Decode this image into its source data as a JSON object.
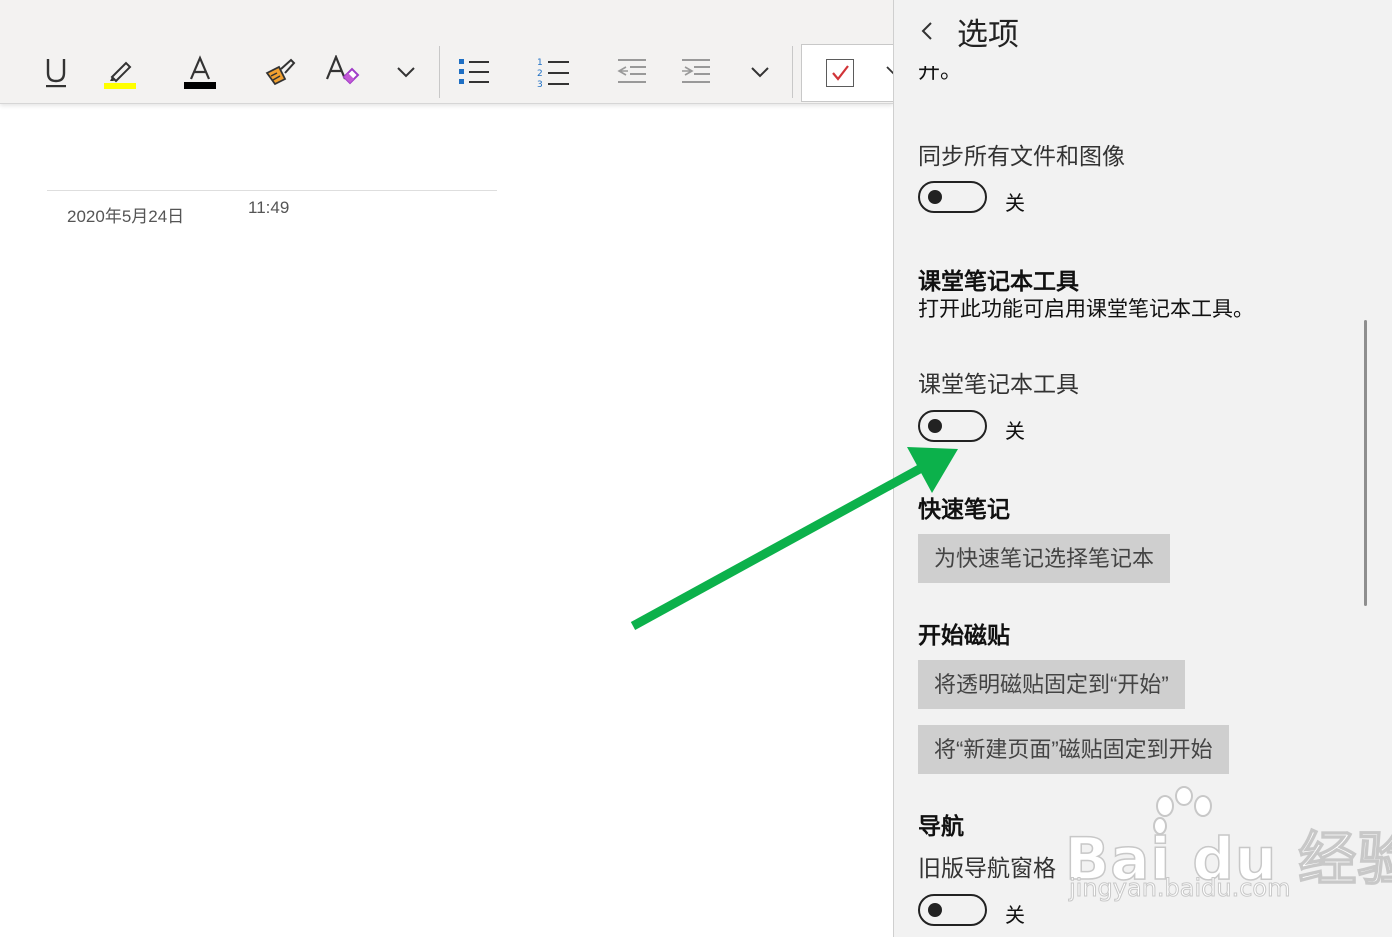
{
  "toolbar": {
    "buttons": [
      {
        "name": "underline-button",
        "icon": "underline-icon"
      },
      {
        "name": "highlight-button",
        "icon": "highlighter-icon",
        "color": "#ffff00"
      },
      {
        "name": "font-color-button",
        "icon": "font-color-icon",
        "color": "#000000"
      },
      {
        "name": "format-painter-button",
        "icon": "format-painter-icon"
      },
      {
        "name": "clear-formatting-button",
        "icon": "clear-formatting-icon"
      },
      {
        "name": "more-formatting-button",
        "icon": "chevron-down-icon"
      },
      {
        "name": "bulleted-list-button",
        "icon": "bullet-list-icon"
      },
      {
        "name": "numbered-list-button",
        "icon": "numbered-list-icon"
      },
      {
        "name": "decrease-indent-button",
        "icon": "decrease-indent-icon"
      },
      {
        "name": "increase-indent-button",
        "icon": "increase-indent-icon"
      },
      {
        "name": "more-paragraph-button",
        "icon": "chevron-down-icon"
      },
      {
        "name": "todo-tag-button",
        "icon": "checkbox-icon"
      }
    ]
  },
  "page": {
    "date": "2020年5月24日",
    "time": "11:49"
  },
  "panel": {
    "title": "选项",
    "cutoff_text": "开。",
    "sync_label": "同步所有文件和图像",
    "sync_toggle_state": "关",
    "class_header": "课堂笔记本工具",
    "class_desc": "打开此功能可启用课堂笔记本工具。",
    "class_label": "课堂笔记本工具",
    "class_toggle_state": "关",
    "quick_header": "快速笔记",
    "quick_button": "为快速笔记选择笔记本",
    "tile_header": "开始磁贴",
    "tile_button_1": "将透明磁贴固定到“开始”",
    "tile_button_2": "将“新建页面”磁贴固定到开始",
    "nav_header": "导航",
    "nav_label": "旧版导航窗格",
    "nav_toggle_state": "关"
  },
  "annotation": {
    "arrow_color": "#0cb14b"
  },
  "watermark": {
    "logo_text": "Bai du 经验",
    "url": "jingyan.baidu.com"
  }
}
